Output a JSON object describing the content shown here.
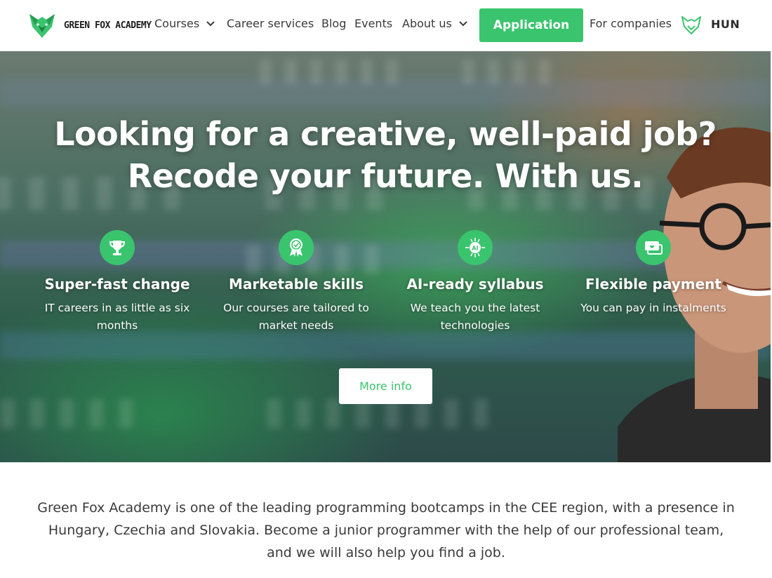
{
  "nav": {
    "logo_text": "GREEN FOX ACADEMY",
    "courses": "Courses",
    "career_services": "Career services",
    "blog": "Blog",
    "events": "Events",
    "about_us": "About us",
    "application": "Application",
    "for_companies": "For companies",
    "language": "HUN"
  },
  "hero": {
    "title_line1": "Looking for a creative, well-paid job?",
    "title_line2": "Recode your future. With us.",
    "features": [
      {
        "icon": "trophy-icon",
        "title": "Super-fast change",
        "desc": "IT careers in as little as six months"
      },
      {
        "icon": "award-ribbon-icon",
        "title": "Marketable skills",
        "desc": "Our courses are tailored to market needs"
      },
      {
        "icon": "ai-chip-icon",
        "title": "AI-ready syllabus",
        "desc": "We teach you the latest technologies"
      },
      {
        "icon": "money-icon",
        "title": "Flexible payment",
        "desc": "You can pay in instalments"
      }
    ],
    "more_info": "More info"
  },
  "intro": {
    "text": "Green Fox Academy is one of the leading programming bootcamps in the CEE region, with a presence in Hungary, Czechia and Slovakia. Become a junior programmer with the help of our professional team, and we will also help you find a job."
  },
  "colors": {
    "accent": "#3ac46e",
    "text": "#3a3a3a"
  }
}
